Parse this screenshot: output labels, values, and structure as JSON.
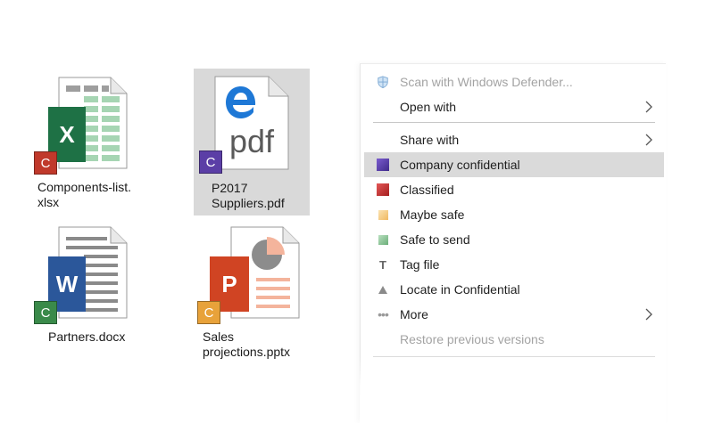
{
  "files": [
    {
      "label": "Components-list.\nxlsx",
      "tile_letter": "X",
      "badge_letter": "C",
      "tile_color": "#1e7145",
      "badge_color": "#c0392b"
    },
    {
      "label": "P2017\nSuppliers.pdf",
      "tile_letter": "pdf",
      "badge_letter": "C",
      "badge_color": "#5b3ea6",
      "selected": true
    },
    {
      "label": "Partners.docx",
      "tile_letter": "W",
      "badge_letter": "C",
      "tile_color": "#2b579a",
      "badge_color": "#3a8a4a"
    },
    {
      "label": "Sales\nprojections.pptx",
      "tile_letter": "P",
      "badge_letter": "C",
      "tile_color": "#d04423",
      "badge_color": "#e8a23a"
    }
  ],
  "menu": {
    "items": [
      {
        "label": "Scan with Windows Defender...",
        "icon": "windows-defender-icon",
        "disabled": true
      },
      {
        "label": "Open with",
        "submenu": true
      },
      {
        "label": "Share with",
        "submenu": true
      },
      {
        "label": "Company confidential",
        "icon": "purple-square-icon",
        "icon_color": "#5b3ea6",
        "highlight": true
      },
      {
        "label": "Classified",
        "icon": "red-square-icon",
        "icon_color": "#c62828"
      },
      {
        "label": "Maybe safe",
        "icon": "orange-square-icon",
        "icon_color": "#f3c56d"
      },
      {
        "label": "Safe to send",
        "icon": "green-square-icon",
        "icon_color": "#7fbf8a"
      },
      {
        "label": "Tag file",
        "icon": "tag-t-icon"
      },
      {
        "label": "Locate in Confidential",
        "icon": "triangle-up-icon"
      },
      {
        "label": "More",
        "icon": "ellipsis-icon",
        "submenu": true
      },
      {
        "label": "Restore previous versions",
        "disabled": true
      }
    ]
  }
}
